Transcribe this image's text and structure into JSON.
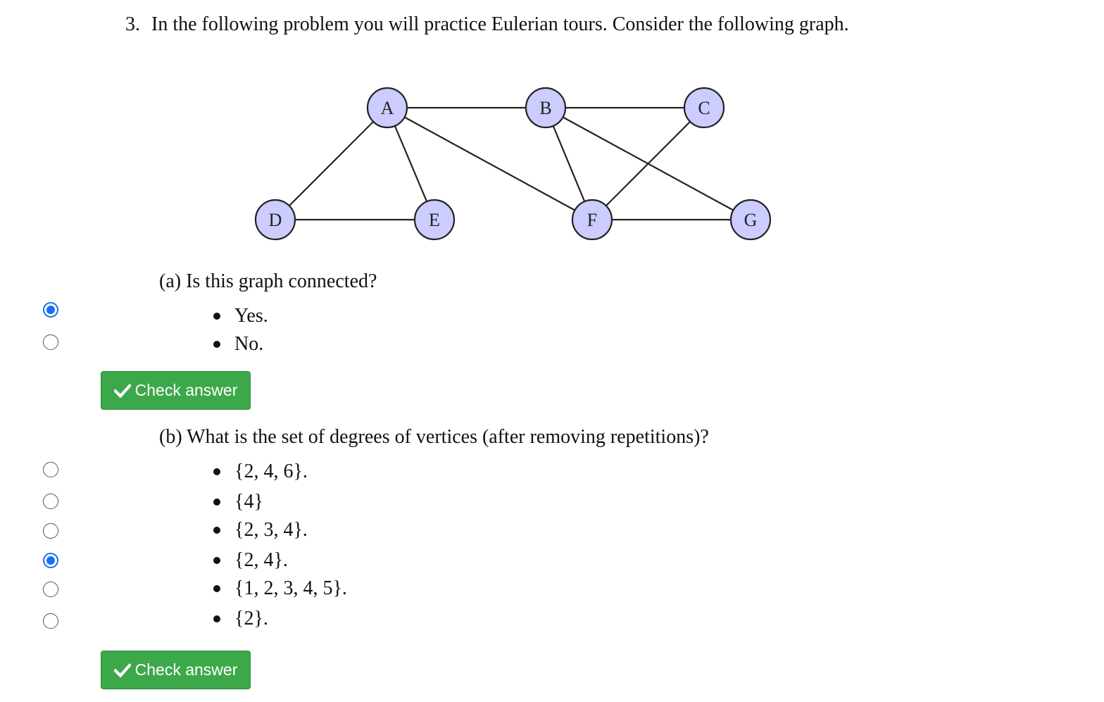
{
  "question": {
    "number": "3.",
    "text": "In the following problem you will practice Eulerian tours. Consider the following graph."
  },
  "graph": {
    "node_fill": "#ccccff",
    "nodes": [
      "A",
      "B",
      "C",
      "D",
      "E",
      "F",
      "G"
    ],
    "edges": [
      [
        "A",
        "B"
      ],
      [
        "B",
        "C"
      ],
      [
        "A",
        "D"
      ],
      [
        "A",
        "E"
      ],
      [
        "A",
        "F"
      ],
      [
        "B",
        "F"
      ],
      [
        "B",
        "G"
      ],
      [
        "C",
        "F"
      ],
      [
        "D",
        "E"
      ],
      [
        "F",
        "G"
      ]
    ]
  },
  "part_a": {
    "prompt": "(a) Is this graph connected?",
    "options": [
      {
        "label": "Yes.",
        "selected": true
      },
      {
        "label": "No.",
        "selected": false
      }
    ],
    "button_label": "Check answer"
  },
  "part_b": {
    "prompt": "(b) What is the set of degrees of vertices (after removing repetitions)?",
    "options": [
      {
        "label": "{2, 4, 6}.",
        "selected": false
      },
      {
        "label": "{4}",
        "selected": false
      },
      {
        "label": "{2, 3, 4}.",
        "selected": false
      },
      {
        "label": "{2, 4}.",
        "selected": true
      },
      {
        "label": "{1, 2, 3, 4, 5}.",
        "selected": false
      },
      {
        "label": "{2}.",
        "selected": false
      }
    ],
    "button_label": "Check answer"
  },
  "colors": {
    "button_bg": "#3da84a",
    "radio_accent": "#1a6ff0"
  },
  "icons": {
    "button_icon": "check-icon"
  }
}
